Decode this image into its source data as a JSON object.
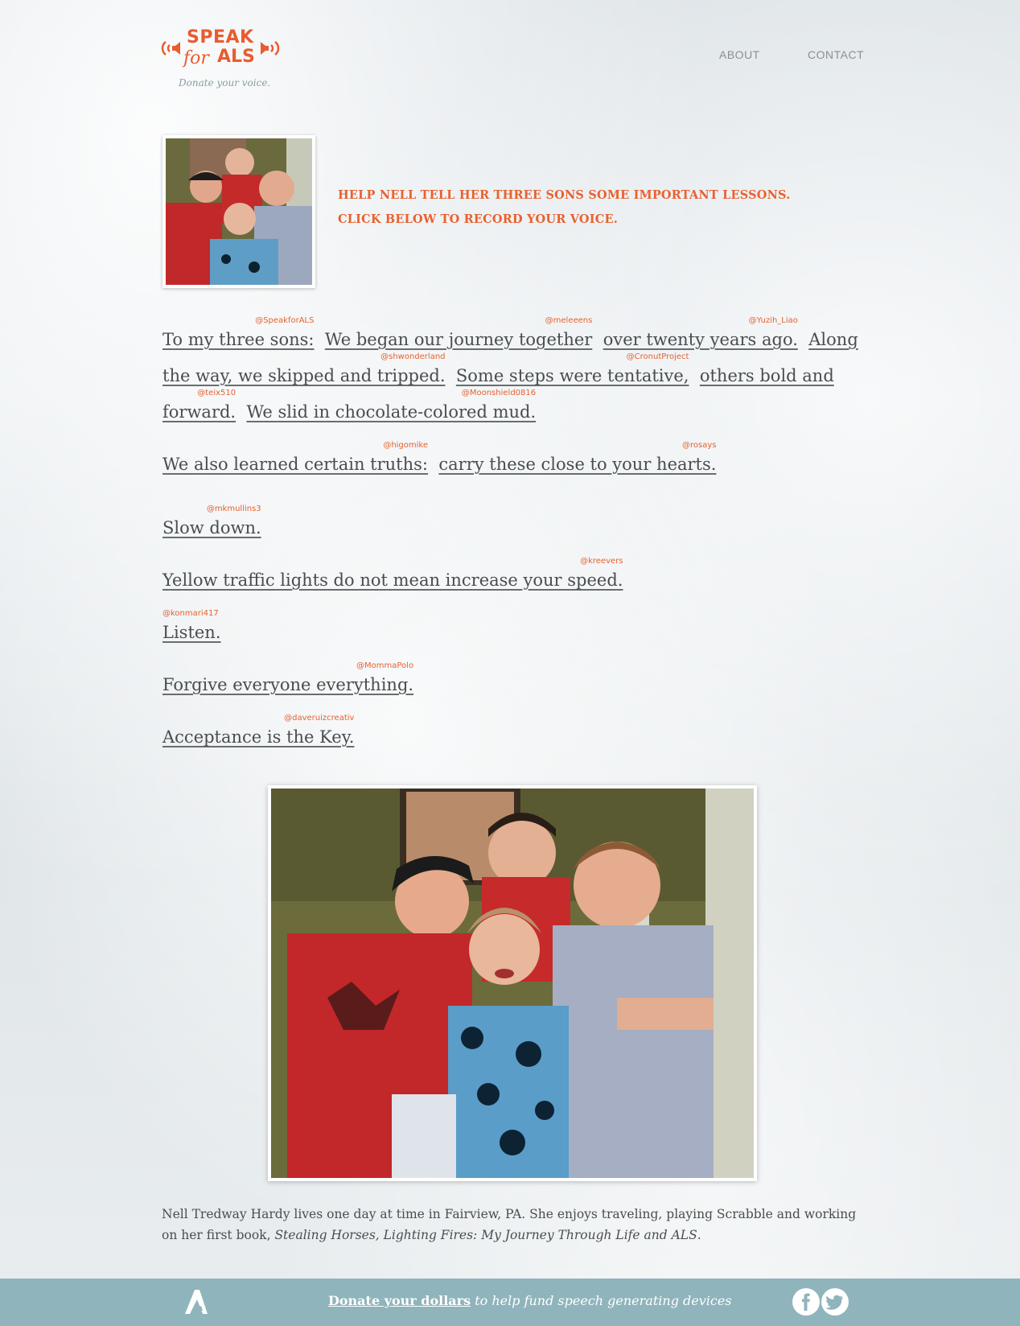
{
  "brand": {
    "logo_line1": "SPEAK",
    "logo_line2_for": "for",
    "logo_line2_als": "ALS",
    "tagline": "Donate your voice."
  },
  "nav": {
    "about": "ABOUT",
    "contact": "CONTACT"
  },
  "hero": {
    "cta_line1": "HELP NELL TELL HER THREE SONS SOME IMPORTANT LESSONS.",
    "cta_line2": "CLICK BELOW TO RECORD YOUR VOICE."
  },
  "poem": {
    "l1": [
      {
        "text": "To my three sons:",
        "handle": "@SpeakforALS"
      },
      {
        "text": "We began our journey together",
        "handle": "@meleeens"
      },
      {
        "text": "over twenty years ago.",
        "handle": "@Yuzih_Liao"
      },
      {
        "text": "Along",
        "handle": ""
      }
    ],
    "l2": [
      {
        "text": "the way, we skipped and tripped.",
        "handle": "@shwonderland"
      },
      {
        "text": "Some steps were tentative,",
        "handle": "@CronutProject"
      },
      {
        "text": "others bold and",
        "handle": ""
      }
    ],
    "l3": [
      {
        "text": "forward.",
        "handle": "@teix510"
      },
      {
        "text": "We slid in chocolate-colored mud.",
        "handle": "@Moonshield0816"
      }
    ],
    "l4": [
      {
        "text": "We also learned certain truths:",
        "handle": "@higomike"
      },
      {
        "text": "carry these close to your hearts.",
        "handle": "@rosays"
      }
    ],
    "l5": [
      {
        "text": "Slow down.",
        "handle": "@mkmullins3"
      }
    ],
    "l6": [
      {
        "text": "Yellow traffic lights do not mean increase your speed.",
        "handle": "@kreevers"
      }
    ],
    "l7": [
      {
        "text": "Listen.",
        "handle": "@konmari417"
      }
    ],
    "l8": [
      {
        "text": "Forgive everyone everything.",
        "handle": "@MommaPolo"
      }
    ],
    "l9": [
      {
        "text": "Acceptance is the Key.",
        "handle": "@daveruizcreativ"
      }
    ]
  },
  "bio": {
    "text": "Nell Tredway Hardy lives one day at time in Fairview, PA. She enjoys traveling, playing Scrabble and working on her first book, ",
    "book_title": "Stealing Horses, Lighting Fires: My Journey Through Life and ALS",
    "end": "."
  },
  "footer": {
    "donate_link": "Donate your dollars",
    "donate_rest": " to help fund speech generating devices"
  },
  "colors": {
    "accent": "#e8612f",
    "footer_bg": "#8fb4bc",
    "text": "#4a4d4f"
  },
  "icons": [
    "speaker-left-icon",
    "speaker-right-icon",
    "als-logo-icon",
    "facebook-icon",
    "twitter-icon"
  ]
}
